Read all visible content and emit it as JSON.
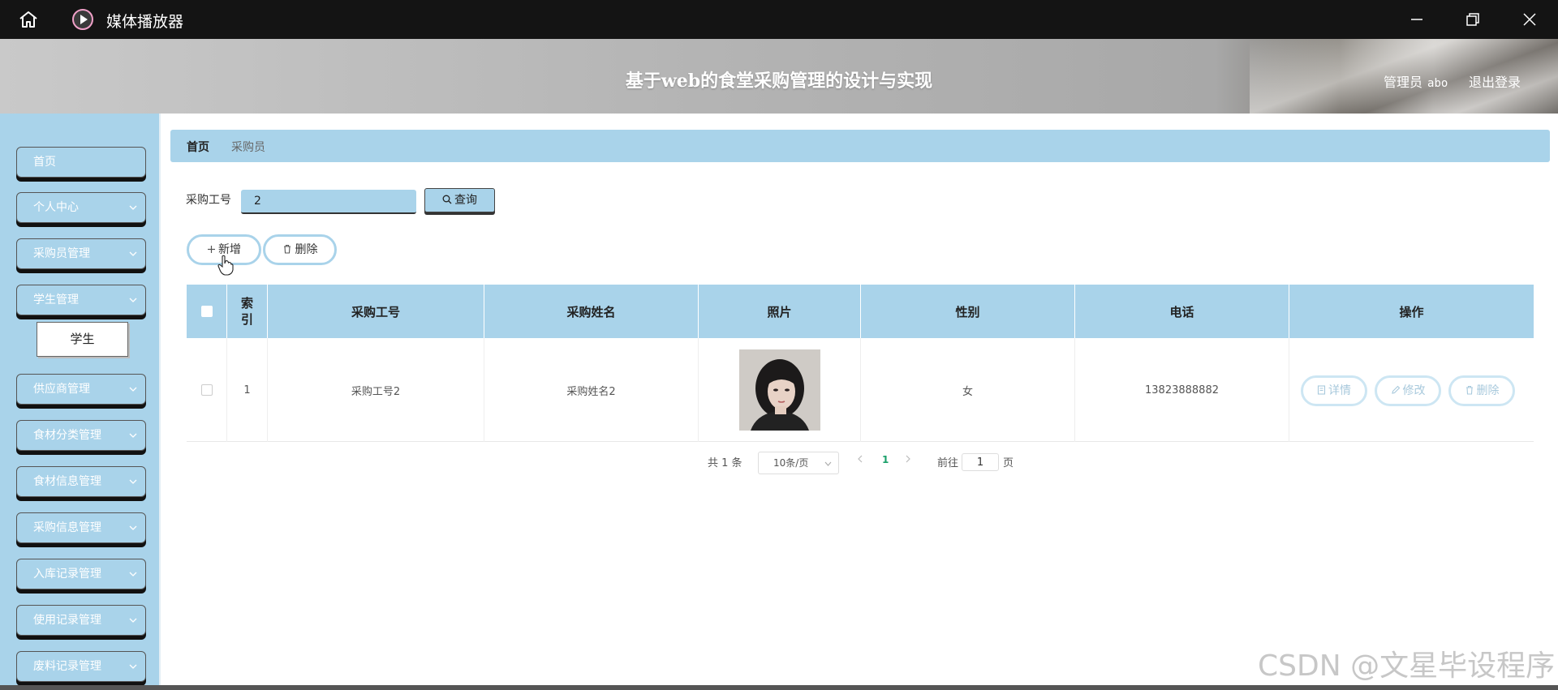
{
  "window": {
    "title": "媒体播放器"
  },
  "header": {
    "title": "基于web的食堂采购管理的设计与实现",
    "role": "管理员",
    "username": "abo",
    "logout": "退出登录"
  },
  "sidebar": {
    "items": [
      {
        "label": "首页"
      },
      {
        "label": "个人中心"
      },
      {
        "label": "采购员管理"
      },
      {
        "label": "学生管理"
      },
      {
        "label": "供应商管理"
      },
      {
        "label": "食材分类管理"
      },
      {
        "label": "食材信息管理"
      },
      {
        "label": "采购信息管理"
      },
      {
        "label": "入库记录管理"
      },
      {
        "label": "使用记录管理"
      },
      {
        "label": "废料记录管理"
      }
    ],
    "submenu": {
      "label": "学生"
    }
  },
  "breadcrumb": {
    "home": "首页",
    "current": "采购员"
  },
  "search": {
    "label": "采购工号",
    "value": "2",
    "button": "查询"
  },
  "actions": {
    "add": "新增",
    "delete": "删除"
  },
  "table": {
    "columns": [
      "索引",
      "采购工号",
      "采购姓名",
      "照片",
      "性别",
      "电话",
      "操作"
    ],
    "rows": [
      {
        "index": "1",
        "id": "采购工号2",
        "name": "采购姓名2",
        "gender": "女",
        "phone": "13823888882",
        "ops": [
          "详情",
          "修改",
          "删除"
        ]
      }
    ]
  },
  "pagination": {
    "total": "共 1 条",
    "page_size": "10条/页",
    "current_page": "1",
    "goto_label": "前往",
    "goto_value": "1",
    "page_suffix": "页"
  },
  "watermark": "CSDN @文星毕设程序",
  "colors": {
    "accent": "#a9d3ea",
    "titlebar": "#141414",
    "active_page": "#1aa06a"
  }
}
